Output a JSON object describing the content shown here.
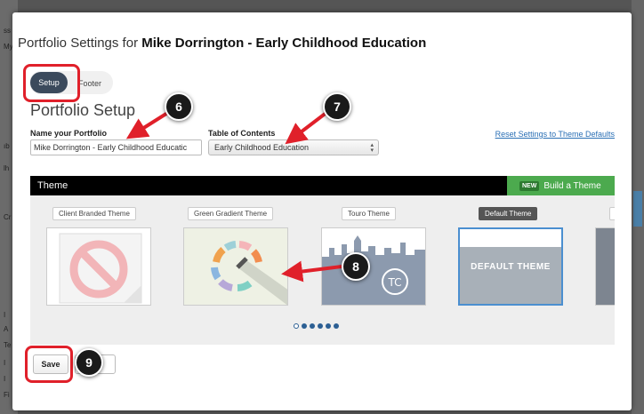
{
  "modal": {
    "title_prefix": "Portfolio Settings for ",
    "title_name": "Mike Dorrington - Early Childhood Education"
  },
  "tabs": [
    {
      "label": "Setup",
      "active": true
    },
    {
      "label": "Footer",
      "active": false
    }
  ],
  "section_title": "Portfolio Setup",
  "form": {
    "name_label": "Name your Portfolio",
    "name_value": "Mike Dorrington - Early Childhood Educatic",
    "toc_label": "Table of Contents",
    "toc_selected": "Early Childhood Education",
    "reset_link": "Reset Settings to Theme Defaults"
  },
  "theme_section": {
    "header": "Theme",
    "new_badge": "NEW",
    "build_label": "Build a Theme",
    "themes": [
      {
        "label": "Client Branded Theme",
        "icon": "no-sign-icon"
      },
      {
        "label": "Green Gradient Theme",
        "icon": "palette-icon"
      },
      {
        "label": "Touro Theme",
        "icon": "skyline-logo-icon"
      },
      {
        "label": "Default Theme",
        "selected": true,
        "thumb_text": "DEFAULT THEME"
      }
    ],
    "pager_dots": 6,
    "pager_active": 1
  },
  "buttons": {
    "save": "Save"
  },
  "annotations": [
    "6",
    "7",
    "8",
    "9"
  ],
  "colors": {
    "accent_red": "#e0202a",
    "tab_active": "#3b4a5c",
    "build_green": "#4caa4e",
    "link_blue": "#2a6fb5",
    "selected_border": "#4b8fd0"
  }
}
